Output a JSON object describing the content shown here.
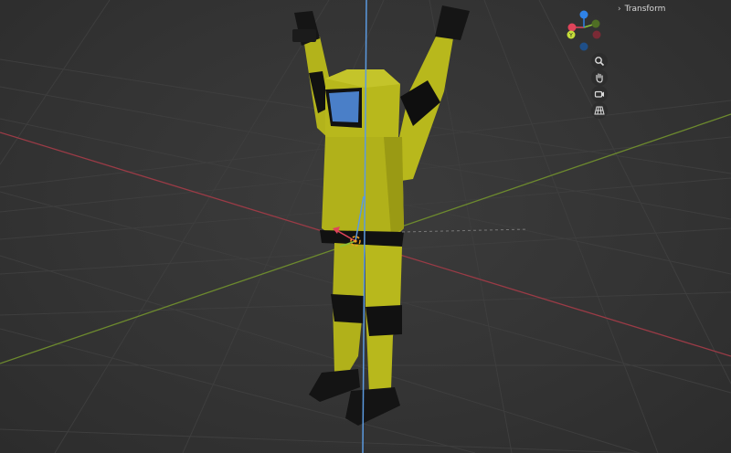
{
  "viewport": {
    "panel_tab": {
      "label": "Transform",
      "chevron": "chevron-right-icon"
    },
    "gizmo_axes": {
      "x": {
        "color": "#e0445a"
      },
      "y": {
        "color": "#8ac23a",
        "label": "Y"
      },
      "z": {
        "color": "#2f83e8"
      }
    },
    "nav_tools": [
      {
        "name": "zoom-icon"
      },
      {
        "name": "pan-hand-icon"
      },
      {
        "name": "camera-view-icon"
      },
      {
        "name": "perspective-grid-icon"
      }
    ]
  },
  "colors": {
    "suit_yellow": "#b8b81c",
    "suit_shadow": "#8a8a12",
    "suit_band": "#111111",
    "visor": "#4a7fc8",
    "grid_line": "#3f3f3f",
    "x_axis_line": "#9a3b46",
    "y_axis_line": "#6d8a2e",
    "z_axis_line": "#4f8fd6",
    "origin_marker": "#f0a020"
  }
}
